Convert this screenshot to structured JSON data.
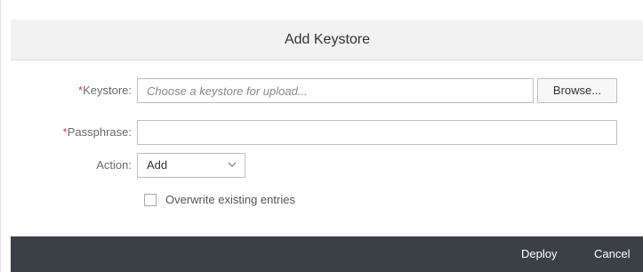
{
  "dialog": {
    "title": "Add Keystore"
  },
  "form": {
    "keystore": {
      "required_mark": "*",
      "label": "Keystore:",
      "placeholder": "Choose a keystore for upload...",
      "value": "",
      "browse_label": "Browse..."
    },
    "passphrase": {
      "required_mark": "*",
      "label": "Passphrase:",
      "value": ""
    },
    "action": {
      "label": "Action:",
      "selected": "Add",
      "icon": "chevron-down-icon"
    },
    "overwrite": {
      "label": "Overwrite existing entries",
      "checked": false
    }
  },
  "footer": {
    "deploy_label": "Deploy",
    "cancel_label": "Cancel",
    "background": "#3b4046"
  }
}
